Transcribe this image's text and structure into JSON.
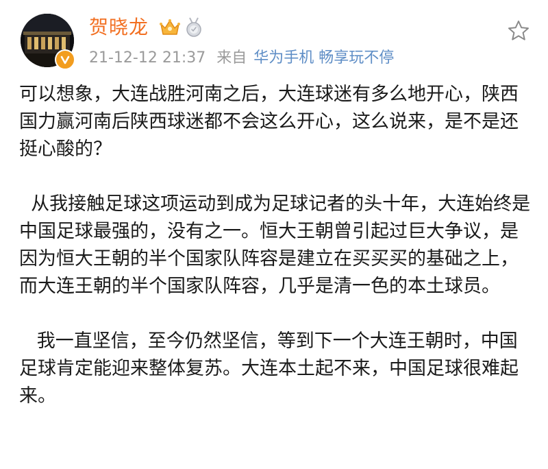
{
  "post": {
    "author": "贺晓龙",
    "timestamp": "21-12-12 21:37",
    "from_label": "来自",
    "source": "华为手机 畅享玩不停",
    "favorite_icon": "star-outline-icon",
    "verify_icon": "verified-v-icon",
    "badges": [
      "vip-crown-icon",
      "silver-medal-icon"
    ],
    "colors": {
      "author": "#f26f21",
      "meta": "#9a9a9a",
      "source_link": "#5f8ec6",
      "verify": "#f29d1f"
    },
    "paragraphs": [
      "可以想象，大连战胜河南之后，大连球迷有多么地开心，陕西国力赢河南后陕西球迷都不会这么开心，这么说来，是不是还挺心酸的？",
      "  从我接触足球这项运动到成为足球记者的头十年，大连始终是中国足球最强的，没有之一。恒大王朝曾引起过巨大争议，是因为恒大王朝的半个国家队阵容是建立在买买买的基础之上，而大连王朝的半个国家队阵容，几乎是清一色的本土球员。",
      "   我一直坚信，至今仍然坚信，等到下一个大连王朝时，中国足球肯定能迎来整体复苏。大连本土起不来，中国足球很难起来。"
    ]
  }
}
